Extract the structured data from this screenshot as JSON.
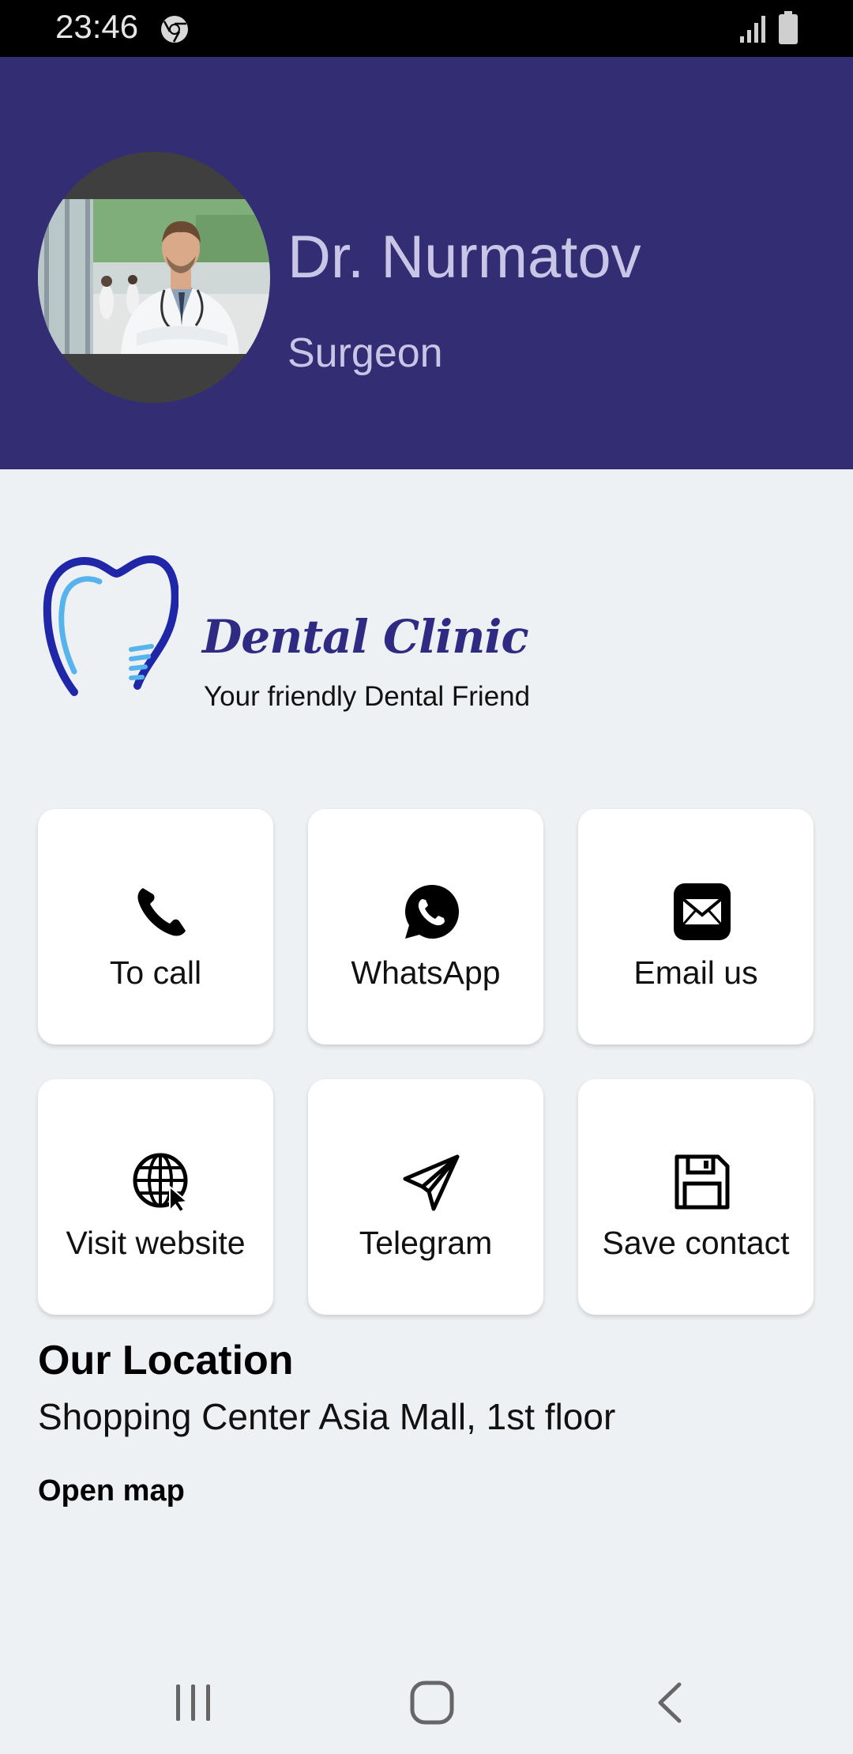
{
  "status_bar": {
    "time": "23:46",
    "icons": [
      "chrome-icon",
      "signal-icon",
      "battery-icon"
    ]
  },
  "profile": {
    "name": "Dr. Nurmatov",
    "role": "Surgeon"
  },
  "clinic": {
    "name": "Dental Clinic",
    "tagline": "Your friendly Dental Friend"
  },
  "actions": [
    {
      "label": "To call",
      "icon": "phone-icon"
    },
    {
      "label": "WhatsApp",
      "icon": "whatsapp-icon"
    },
    {
      "label": "Email us",
      "icon": "email-icon"
    },
    {
      "label": "Visit website",
      "icon": "globe-icon"
    },
    {
      "label": "Telegram",
      "icon": "telegram-icon"
    },
    {
      "label": "Save contact",
      "icon": "save-icon"
    }
  ],
  "location": {
    "title": "Our Location",
    "address": "Shopping Center Asia Mall, 1st floor",
    "map_link": "Open map"
  },
  "nav_bar": {
    "icons": [
      "recents-icon",
      "home-icon",
      "back-icon"
    ]
  },
  "colors": {
    "header_bg": "#332d74",
    "header_text": "#c8c5e6",
    "page_bg": "#eef1f3",
    "clinic_brand": "#2f2b82",
    "card_bg": "#ffffff"
  }
}
